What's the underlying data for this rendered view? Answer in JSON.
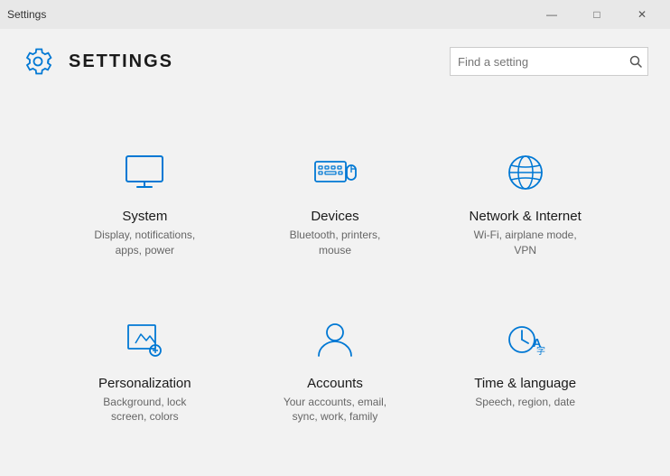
{
  "titleBar": {
    "title": "Settings",
    "minBtn": "—",
    "maxBtn": "□",
    "closeBtn": "✕"
  },
  "header": {
    "title": "SETTINGS",
    "searchPlaceholder": "Find a setting"
  },
  "items": [
    {
      "id": "system",
      "name": "System",
      "desc": "Display, notifications, apps, power"
    },
    {
      "id": "devices",
      "name": "Devices",
      "desc": "Bluetooth, printers, mouse"
    },
    {
      "id": "network",
      "name": "Network & Internet",
      "desc": "Wi-Fi, airplane mode, VPN"
    },
    {
      "id": "personalization",
      "name": "Personalization",
      "desc": "Background, lock screen, colors"
    },
    {
      "id": "accounts",
      "name": "Accounts",
      "desc": "Your accounts, email, sync, work, family"
    },
    {
      "id": "time",
      "name": "Time & language",
      "desc": "Speech, region, date"
    }
  ]
}
